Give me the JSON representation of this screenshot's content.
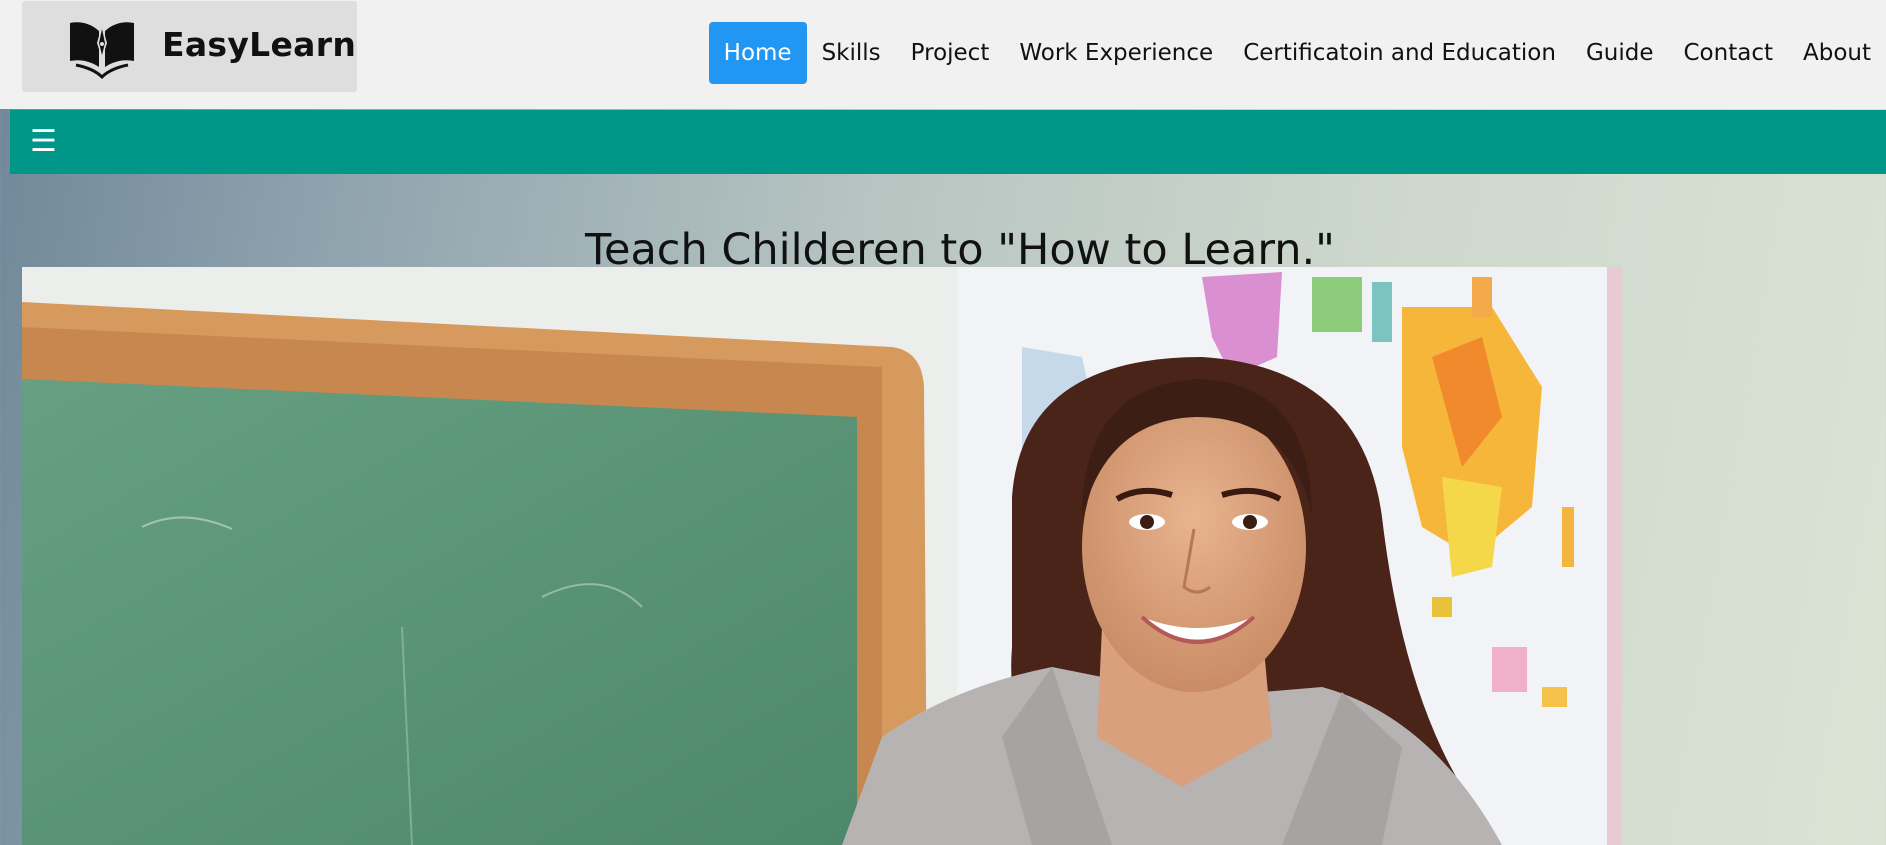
{
  "brand": {
    "name": "EasyLearn",
    "logo_icon": "open-book-pen-icon"
  },
  "nav": {
    "items": [
      {
        "label": "Home",
        "active": true
      },
      {
        "label": "Skills",
        "active": false
      },
      {
        "label": "Project",
        "active": false
      },
      {
        "label": "Work Experience",
        "active": false
      },
      {
        "label": "Certificatoin and Education",
        "active": false
      },
      {
        "label": "Guide",
        "active": false
      },
      {
        "label": "Contact",
        "active": false
      },
      {
        "label": "About",
        "active": false
      }
    ],
    "active_color": "#2196f3"
  },
  "toolbar": {
    "menu_icon": "hamburger-menu-icon",
    "menu_glyph": "☰",
    "color": "#009688"
  },
  "main": {
    "title": "Teach Childeren to \"How to Learn.\"",
    "hero_image": "teacher-smiling-at-chalkboard-photo"
  }
}
